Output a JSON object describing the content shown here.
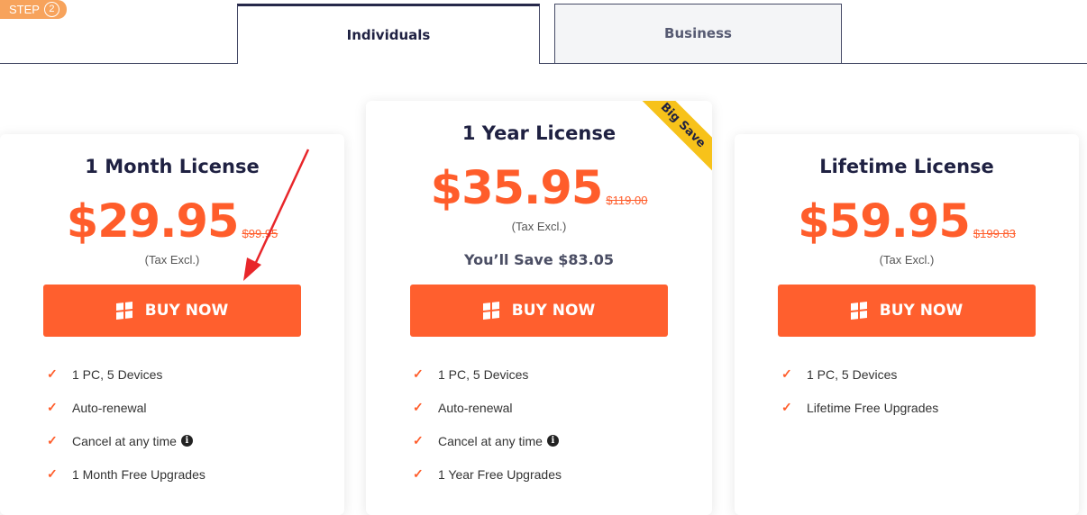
{
  "step": {
    "label": "STEP",
    "number": "2"
  },
  "tabs": [
    {
      "label": "Individuals",
      "active": true
    },
    {
      "label": "Business",
      "active": false
    }
  ],
  "colors": {
    "accent": "#ff5f2e",
    "ribbon": "#f7c21a",
    "navy": "#1f2142"
  },
  "plans": [
    {
      "title": "1 Month License",
      "price": "$29.95",
      "old_price": "$99.95",
      "tax": "(Tax Excl.)",
      "buy_label": "BUY NOW",
      "features": [
        "1 PC, 5 Devices",
        "Auto-renewal",
        "Cancel at any time",
        "1 Month Free Upgrades"
      ]
    },
    {
      "title": "1 Year License",
      "price": "$35.95",
      "old_price": "$119.00",
      "tax": "(Tax Excl.)",
      "save": "You’ll Save $83.05",
      "ribbon": "Big Save",
      "buy_label": "BUY NOW",
      "features": [
        "1 PC, 5 Devices",
        "Auto-renewal",
        "Cancel at any time",
        "1 Year Free Upgrades"
      ]
    },
    {
      "title": "Lifetime License",
      "price": "$59.95",
      "old_price": "$199.83",
      "tax": "(Tax Excl.)",
      "buy_label": "BUY NOW",
      "features": [
        "1 PC, 5 Devices",
        "Lifetime Free Upgrades"
      ]
    }
  ]
}
